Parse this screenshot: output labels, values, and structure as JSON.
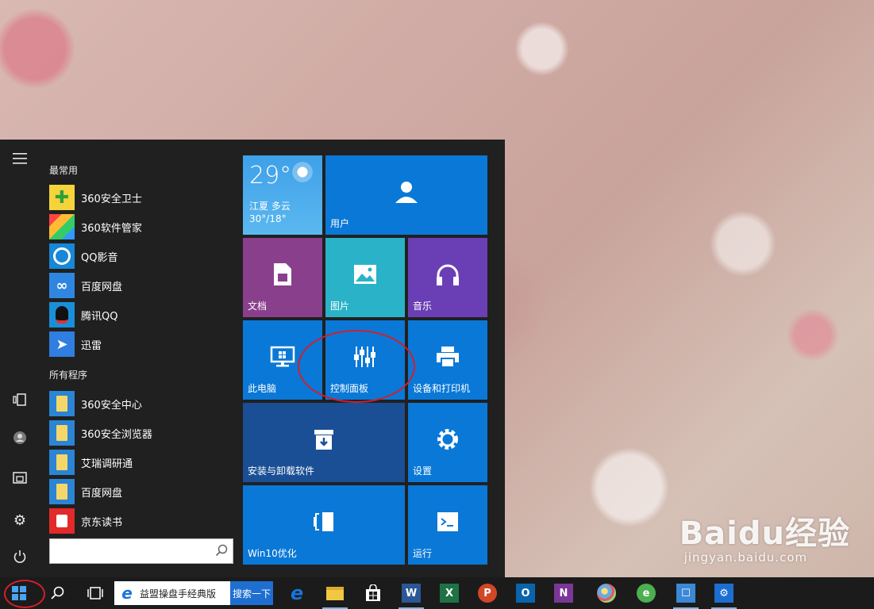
{
  "start_menu": {
    "section_frequent": "最常用",
    "frequent_apps": [
      {
        "label": "360安全卫士",
        "icon": "360-safe-icon",
        "color": "#3bb54a"
      },
      {
        "label": "360软件管家",
        "icon": "360-software-icon",
        "color": "#e9443c"
      },
      {
        "label": "QQ影音",
        "icon": "qq-player-icon",
        "color": "#1787d8"
      },
      {
        "label": "百度网盘",
        "icon": "baidu-netdisk-icon",
        "color": "#3a8ee6"
      },
      {
        "label": "腾讯QQ",
        "icon": "qq-penguin-icon",
        "color": "#1a8fd9"
      },
      {
        "label": "迅雷",
        "icon": "thunder-icon",
        "color": "#2f7ee0"
      }
    ],
    "section_all": "所有程序",
    "all_apps": [
      {
        "label": "360安全中心",
        "icon": "folder-icon"
      },
      {
        "label": "360安全浏览器",
        "icon": "folder-icon"
      },
      {
        "label": "艾瑞调研通",
        "icon": "folder-icon"
      },
      {
        "label": "百度网盘",
        "icon": "folder-icon"
      },
      {
        "label": "京东读书",
        "icon": "jd-read-icon"
      }
    ],
    "search_placeholder": ""
  },
  "tiles": {
    "weather": {
      "temp": "29°",
      "location": "江夏 多云",
      "range": "30°/18°"
    },
    "user": "用户",
    "documents": "文档",
    "pictures": "图片",
    "music": "音乐",
    "this_pc": "此电脑",
    "control_panel": "控制面板",
    "devices_printers": "设备和打印机",
    "install_uninstall": "安装与卸载软件",
    "settings": "设置",
    "win10_optimize": "Win10优化",
    "run": "运行"
  },
  "taskbar": {
    "ie_search_text": "益盟操盘手经典版",
    "ie_search_button": "搜索一下",
    "pinned": [
      {
        "name": "edge-icon",
        "color": "#1a73d9"
      },
      {
        "name": "file-explorer-icon",
        "color": "#f2c744"
      },
      {
        "name": "store-icon",
        "color": "#ffffff"
      },
      {
        "name": "word-icon",
        "color": "#2b5797"
      },
      {
        "name": "excel-icon",
        "color": "#1f7244"
      },
      {
        "name": "powerpoint-icon",
        "color": "#d24726"
      },
      {
        "name": "outlook-icon",
        "color": "#0a64ad"
      },
      {
        "name": "onenote-icon",
        "color": "#7a3797"
      },
      {
        "name": "paint-icon",
        "color": "#6ca9dd"
      },
      {
        "name": "360-browser-icon",
        "color": "#4caf50"
      },
      {
        "name": "contacts-icon",
        "color": "#3a88d6"
      },
      {
        "name": "settings-icon",
        "color": "#1c6fd1"
      }
    ]
  },
  "watermark": {
    "logo": "Baidu经验",
    "url": "jingyan.baidu.com"
  },
  "colors": {
    "tile_blue": "#0a78d7",
    "tile_purple_doc": "#8a3f8c",
    "tile_teal": "#2ab2c8",
    "tile_purple_music": "#6a3fb5",
    "tile_dark_blue": "#1a4f95",
    "annotation_red": "#d21f2a"
  }
}
